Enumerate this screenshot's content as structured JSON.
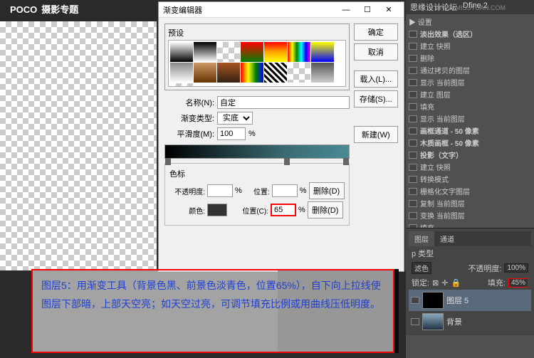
{
  "logo": {
    "brand": "POCO",
    "sub": "摄影专题"
  },
  "topbar": {
    "left": "思缘设计论坛",
    "right": "WWW.MISSYUAN.COM",
    "tab1": "Dfine 2"
  },
  "dialog": {
    "title": "渐变编辑器",
    "buttons": {
      "ok": "确定",
      "cancel": "取消",
      "load": "载入(L)...",
      "save": "存储(S)...",
      "new": "新建(W)",
      "delete1": "删除(D)",
      "delete2": "删除(D)"
    },
    "preset_label": "预设",
    "name_label": "名称(N):",
    "name_value": "自定",
    "type_label": "渐变类型:",
    "type_value": "实底",
    "smooth_label": "平滑度(M):",
    "smooth_value": "100",
    "pct": "%",
    "stops_title": "色标",
    "opacity_label": "不透明度:",
    "pos_label": "位置:",
    "color_label": "颜色:",
    "pos2_label": "位置(C):",
    "pos2_value": "65"
  },
  "annotation": "图层5：用渐变工具（背景色黑、前景色淡青色，位置65%），自下向上拉线使图层下部暗，上部天空亮；如天空过亮，可调节填充比例或用曲线压低明度。",
  "layers": {
    "settings": "▶ 设置",
    "items": [
      {
        "t": "淡出效果（选区）",
        "b": true
      },
      {
        "t": "建立 快照"
      },
      {
        "t": "删除"
      },
      {
        "t": "通过拷贝的图层"
      },
      {
        "t": "显示 当前图层"
      },
      {
        "t": "建立 图层"
      },
      {
        "t": "填充"
      },
      {
        "t": "显示 当前图层"
      },
      {
        "t": "画框通道 - 50 像素",
        "b": true
      },
      {
        "t": "木质画框 - 50 像素",
        "b": true
      },
      {
        "t": "投影（文字）",
        "b": true
      },
      {
        "t": "建立 快照"
      },
      {
        "t": "转换模式"
      },
      {
        "t": "栅格化文字图层"
      },
      {
        "t": "复制 当前图层"
      },
      {
        "t": "变换 当前图层"
      },
      {
        "t": "填充"
      }
    ]
  },
  "layerspanel": {
    "tab1": "图层",
    "tab2": "通道",
    "kind": "p 类型",
    "blend": "滤色",
    "opacity_label": "不透明度:",
    "opacity_value": "100%",
    "lock_label": "锁定:",
    "fill_label": "填充:",
    "fill_value": "45%",
    "layer5": "图层 5",
    "bg": "背景"
  }
}
